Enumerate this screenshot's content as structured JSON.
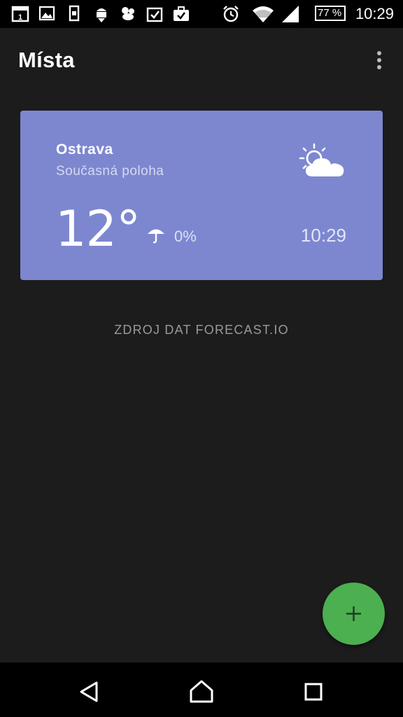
{
  "status_bar": {
    "time": "10:29",
    "battery": "77 %",
    "icons": [
      "calendar-icon",
      "image-icon",
      "device-icon",
      "android-download-icon",
      "bird-icon",
      "task-check-icon",
      "briefcase-check-icon",
      "alarm-icon",
      "wifi-icon",
      "signal-icon",
      "battery-icon"
    ]
  },
  "app_bar": {
    "title": "Místa",
    "menu_icon": "overflow-menu-icon"
  },
  "location_card": {
    "city": "Ostrava",
    "subtitle": "Současná poloha",
    "temperature": "12°",
    "precip_chance": "0%",
    "time": "10:29",
    "weather_icon": "partly-cloudy-icon",
    "precip_icon": "umbrella-icon",
    "background_color": "#7d87d0"
  },
  "attribution": "ZDROJ DAT FORECAST.IO",
  "fab": {
    "icon": "plus-icon",
    "color": "#4caf50"
  },
  "nav_bar": {
    "icons": [
      "back-icon",
      "home-icon",
      "recents-icon"
    ]
  }
}
